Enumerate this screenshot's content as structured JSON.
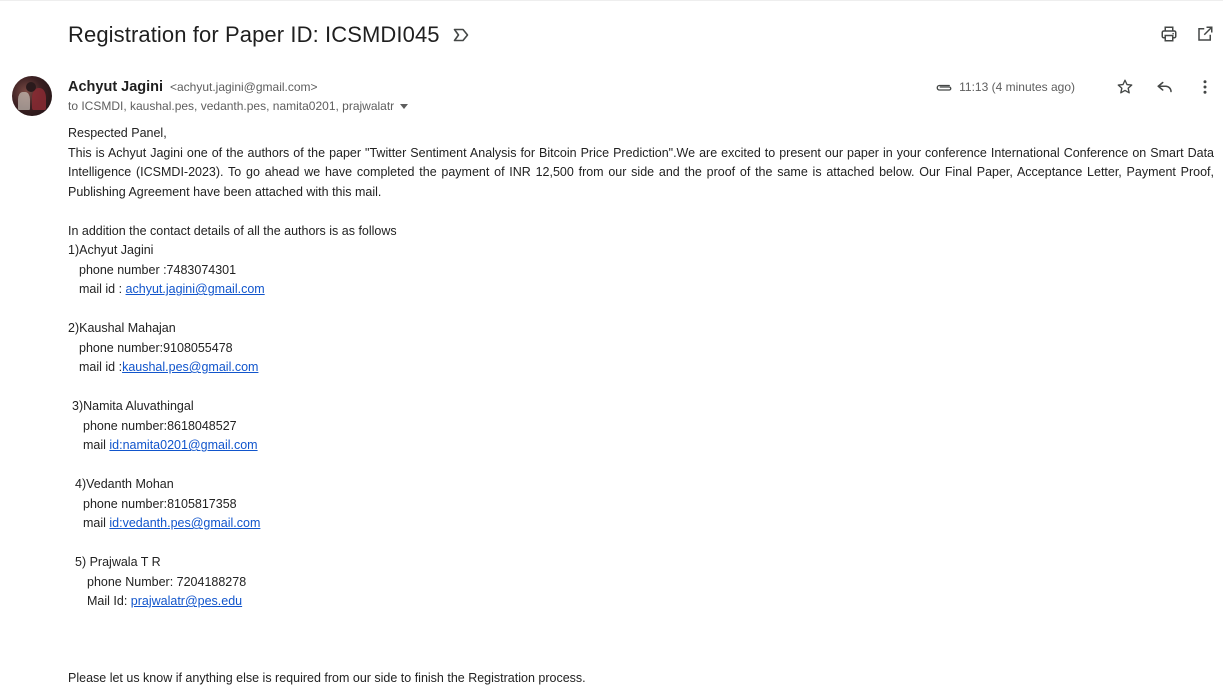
{
  "subject": "Registration for Paper ID: ICSMDI045",
  "icons": {
    "label": "label-icon",
    "print": "print-icon",
    "open_new_window": "open-in-new-window-icon",
    "attachment": "paperclip-icon",
    "star": "star-icon",
    "reply": "reply-icon",
    "more": "more-vertical-icon",
    "recipients_caret": "chevron-down-icon"
  },
  "sender": {
    "name": "Achyut Jagini",
    "email": "<achyut.jagini@gmail.com>",
    "recipients": "to ICSMDI, kaushal.pes, vedanth.pes, namita0201, prajwalatr",
    "timestamp": "11:13 (4 minutes ago)"
  },
  "body": {
    "greeting": "Respected Panel,",
    "intro": "This is Achyut Jagini one of the authors of the paper \"Twitter Sentiment Analysis for Bitcoin Price Prediction\".We are excited to present our paper in your conference International Conference on Smart Data Intelligence (ICSMDI-2023). To go ahead we have completed the payment of INR 12,500 from our side and the proof of the same is attached below. Our Final Paper, Acceptance Letter, Payment Proof,  Publishing Agreement have been attached with this mail.",
    "contacts_intro": "In addition the contact details of all the authors is as follows",
    "authors": [
      {
        "name": "1)Achyut Jagini",
        "phone": "phone number :7483074301",
        "mail_prefix": "mail id : ",
        "mail_link": "achyut.jagini@gmail.com"
      },
      {
        "name": "2)Kaushal Mahajan",
        "phone": "phone number:9108055478",
        "mail_prefix": "mail id :",
        "mail_link": "kaushal.pes@gmail.com"
      },
      {
        "name": "3)Namita Aluvathingal",
        "phone": "phone number:8618048527",
        "mail_prefix": "mail ",
        "mail_link": "id:namita0201@gmail.com"
      },
      {
        "name": "4)Vedanth Mohan",
        "phone": "phone number:8105817358",
        "mail_prefix": "mail ",
        "mail_link": "id:vedanth.pes@gmail.com"
      },
      {
        "name": "5) Prajwala T R",
        "phone": "phone Number: 7204188278",
        "mail_prefix": "Mail Id: ",
        "mail_link": "prajwalatr@pes.edu"
      }
    ],
    "closing": "Please let us know if anything else is required from our side to finish the Registration process."
  },
  "colors": {
    "link": "#1155cc",
    "secondary_text": "#5e5e5e",
    "primary_text": "#222222",
    "icon": "#444746"
  }
}
